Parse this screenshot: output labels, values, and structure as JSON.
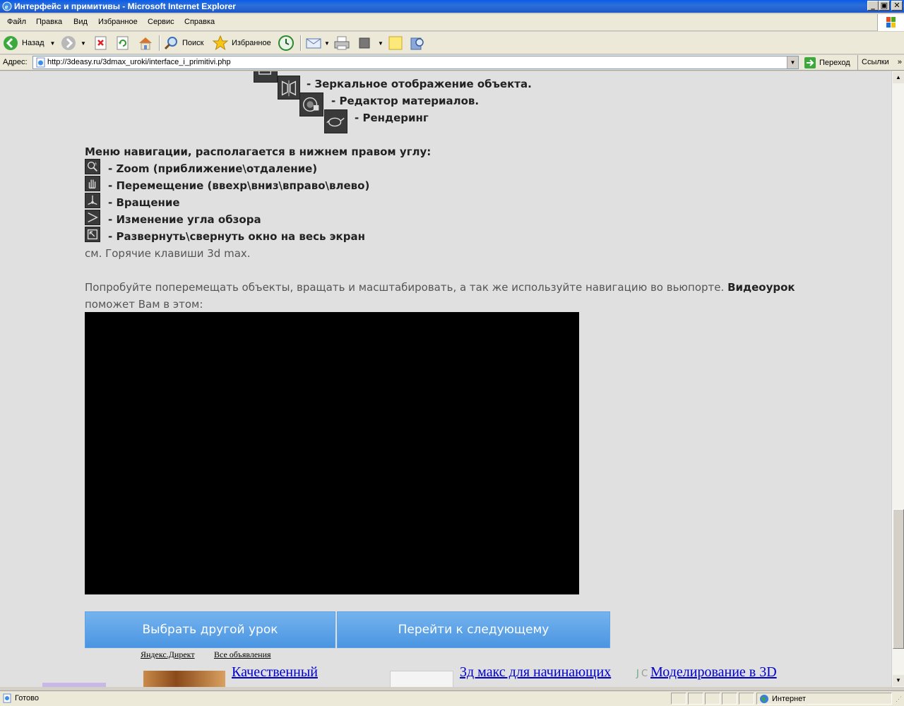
{
  "window": {
    "title": "Интерфейс и примитивы - Microsoft Internet Explorer",
    "minimize": "_",
    "maximize": "▣",
    "close": "✕"
  },
  "menu": [
    "Файл",
    "Правка",
    "Вид",
    "Избранное",
    "Сервис",
    "Справка"
  ],
  "toolbar": {
    "back_label": "Назад",
    "search_label": "Поиск",
    "favorites_label": "Избранное"
  },
  "address": {
    "label": "Адрес:",
    "url": "http://3deasy.ru/3dmax_uroki/interface_i_primitivi.php",
    "go_label": "Переход",
    "links_label": "Ссылки"
  },
  "content": {
    "tool_items": [
      "- Зеркальное отображение объекта.",
      "- Редактор материалов.",
      "- Рендеринг"
    ],
    "nav_heading": "Меню навигации, располагается в нижнем правом углу:",
    "nav_items": [
      "- Zoom (приближение\\отдаление)",
      "- Перемещение (ввехр\\вниз\\вправо\\влево)",
      "- Вращение",
      "- Изменение угла обзора",
      "- Развернуть\\свернуть окно на весь экран"
    ],
    "hotkeys_note": "см. Горячие клавиши 3d max.",
    "intro_text": "Попробуйте поперемещать объекты, вращать и масштабировать, а так же используйте навигацию во вьюпорте.",
    "intro_bold": "Видеоурок",
    "intro_text2": "поможет Вам в этом:",
    "btn_choose": "Выбрать другой урок",
    "btn_next": "Перейти к следующему",
    "yandex_direct": "Яндекс.Директ",
    "all_ads": "Все объявления",
    "ad1": "Качественный",
    "ad2": "3д макс для начинающих",
    "ad3": "Моделирование в 3D"
  },
  "status": {
    "ready": "Готово",
    "zone": "Интернет"
  }
}
